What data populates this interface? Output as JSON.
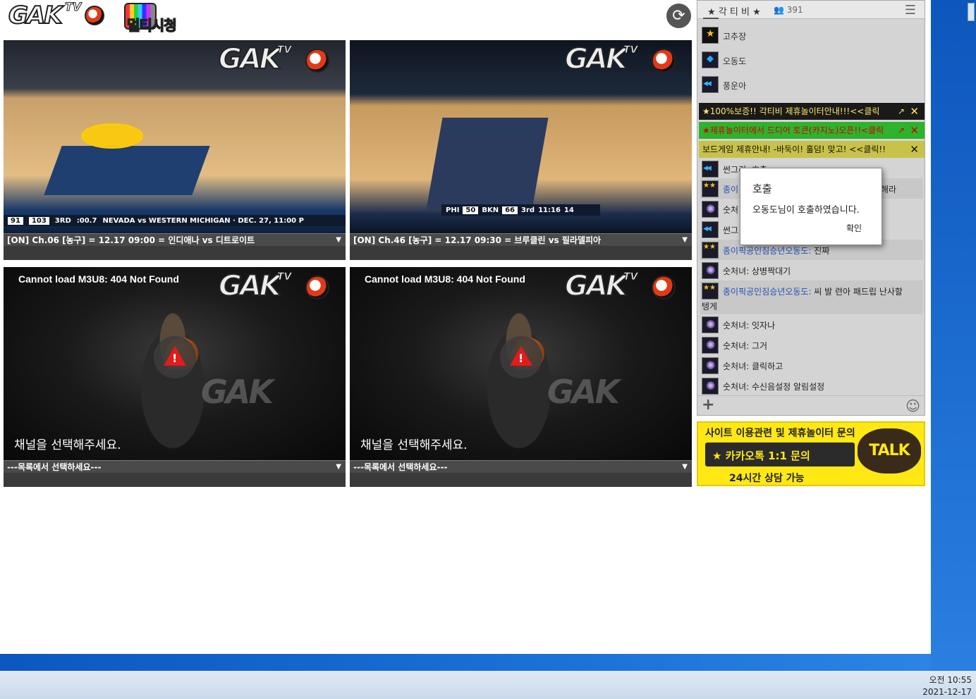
{
  "header": {
    "logo_text": "GAK",
    "logo_sub": "TV",
    "multi_label": "멀티시청"
  },
  "panes": [
    {
      "channel": "[ON] Ch.06 [농구] = 12.17 09:00 = 인디애나 vs 디트로이트",
      "score_away": "91",
      "score_home": "103",
      "period": "3RD",
      "clock": ":00.7",
      "ticker": "NEVADA vs WESTERN MICHIGAN · DEC. 27, 11:00 P"
    },
    {
      "channel": "[ON] Ch.46 [농구] = 12.17 09:30 = 브루클린 vs 필라델피아",
      "score_a_team": "PHI",
      "score_a": "50",
      "score_b_team": "BKN",
      "score_b": "66",
      "period": "3rd",
      "clock": "11:16",
      "shot": "14"
    },
    {
      "error": "Cannot load M3U8: 404 Not Found",
      "hint": "채널을 선택해주세요.",
      "channel": "---목록에서 선택하세요---"
    },
    {
      "error": "Cannot load M3U8: 404 Not Found",
      "hint": "채널을 선택해주세요.",
      "channel": "---목록에서 선택하세요---"
    }
  ],
  "chat": {
    "title": "★ 각 티 비 ★",
    "count": "391",
    "users": [
      {
        "name": "고추장",
        "badge": "gold"
      },
      {
        "name": "오동도",
        "badge": "diamond"
      },
      {
        "name": "풍운아",
        "badge": "chev"
      }
    ],
    "banners": [
      {
        "text": "★100%보증!! 각티비 제휴놀이터안내!!!<<클릭",
        "style": "b1"
      },
      {
        "text": "★제휴놀이터에서 드디어 토큰(카지노)오픈!!<클릭",
        "style": "b2"
      },
      {
        "text": "보드게임 제휴안내! -바둑이! 훌덤! 맞고! <<클릭!!",
        "style": "b3"
      }
    ],
    "messages": [
      {
        "user": "썬그리:",
        "text": " 호출"
      },
      {
        "user": "종이",
        "text": "",
        "tail": "해라"
      },
      {
        "user": "숫처",
        "text": ""
      },
      {
        "user": "썬그",
        "text": ""
      },
      {
        "user": "종이픽공인짐승년오동도:",
        "text": " 진짜"
      },
      {
        "user": "숫처녀:",
        "text": " 상병짝대기"
      },
      {
        "user": "종이픽공인짐승년오동도:",
        "text": " 씨 발 련아 패드립 난사할",
        "wrap": "텡게"
      },
      {
        "user": "숫처녀:",
        "text": " 잇자나"
      },
      {
        "user": "숫처녀:",
        "text": " 그거"
      },
      {
        "user": "숫처녀:",
        "text": " 클릭하고"
      },
      {
        "user": "숫처녀:",
        "text": " 수신음설정 알림설정"
      }
    ]
  },
  "modal": {
    "title": "호출",
    "body": "오동도님이 호출하였습니다.",
    "ok": "확인"
  },
  "ad": {
    "line1": "사이트 이용관련 및 제휴놀이터 문의",
    "line2": "★ 카카오톡 1:1 문의",
    "line3": "24시간 상담 가능",
    "talk": "TALK"
  },
  "taskbar": {
    "time": "오전 10:55",
    "date": "2021-12-17"
  }
}
